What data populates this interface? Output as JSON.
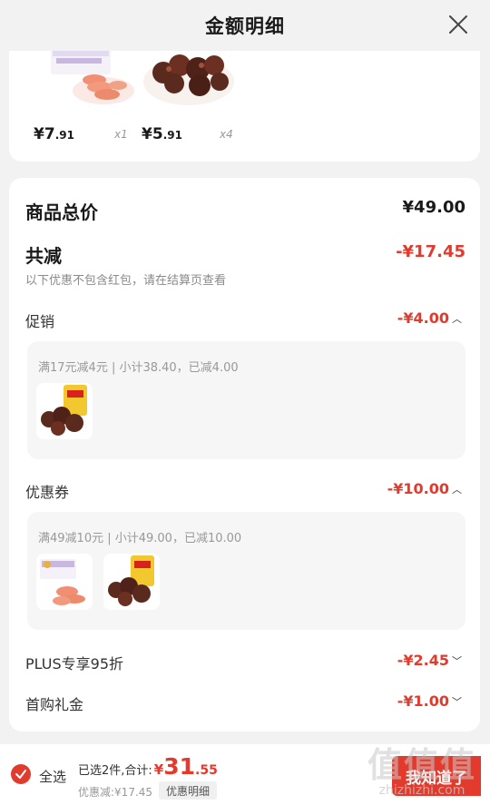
{
  "header": {
    "title": "金额明细"
  },
  "top_items": [
    {
      "price_yen": "¥",
      "price_int": "7",
      "price_dec": ".91",
      "qty": "x1"
    },
    {
      "price_yen": "¥",
      "price_int": "5",
      "price_dec": ".91",
      "qty": "x4"
    }
  ],
  "summary": {
    "total_label": "商品总价",
    "total_value": "¥49.00",
    "reduce_label": "共减",
    "reduce_value": "-¥17.45",
    "note": "以下优惠不包含红包，请在结算页查看"
  },
  "promo": {
    "label": "促销",
    "value": "-¥4.00",
    "detail": "满17元减4元 | 小计38.40，已减4.00"
  },
  "coupon": {
    "label": "优惠券",
    "value": "-¥10.00",
    "detail": "满49减10元 | 小计49.00，已减10.00"
  },
  "plus": {
    "label": "PLUS专享95折",
    "value": "-¥2.45"
  },
  "gift": {
    "label": "首购礼金",
    "value": "-¥1.00"
  },
  "bottom": {
    "select_all": "全选",
    "selected_text": "已选2件,合计:",
    "total_yen": "¥",
    "total_int": "31",
    "total_dec": ".55",
    "discount_line": "优惠减:¥17.45",
    "detail_chip": "优惠明细",
    "know_button": "我知道了"
  },
  "watermark": {
    "main": "值值值",
    "sub": "zhizhizhi.com"
  },
  "colors": {
    "accent": "#e23b2e",
    "background": "#f2f2f2"
  }
}
